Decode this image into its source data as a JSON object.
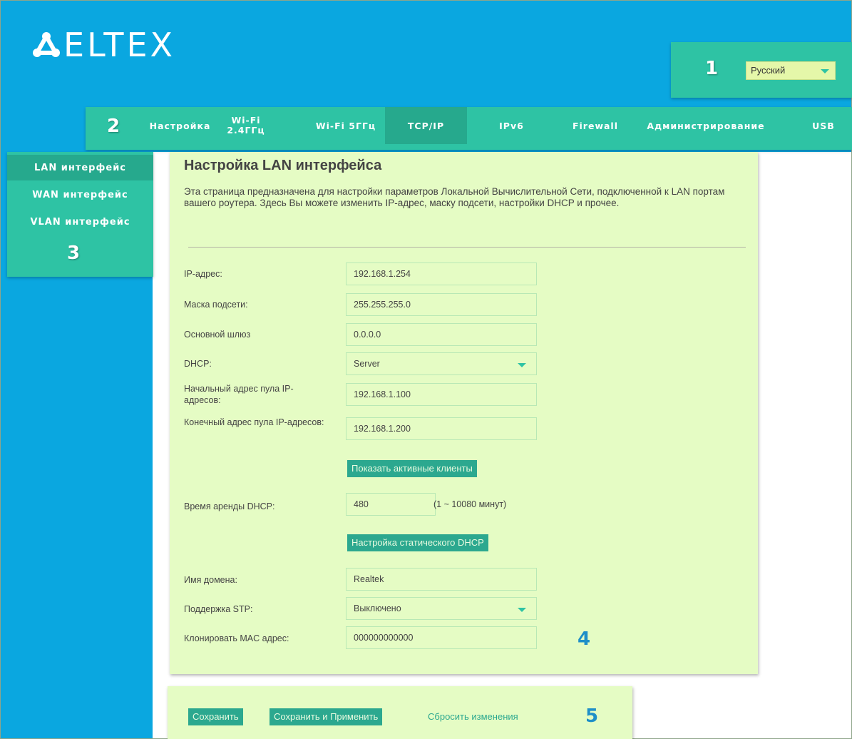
{
  "header": {
    "logo_text": "ELTEX",
    "language": {
      "badge": "1",
      "selected": "Русский"
    }
  },
  "nav": {
    "badge": "2",
    "items": [
      {
        "label": "Настройка",
        "active": false
      },
      {
        "label": "Wi-Fi 2.4ГГц",
        "line1": "Wi-Fi",
        "line2": "2.4ГГц",
        "active": false
      },
      {
        "label": "Wi-Fi 5ГГц",
        "active": false
      },
      {
        "label": "TCP/IP",
        "active": true
      },
      {
        "label": "IPv6",
        "active": false
      },
      {
        "label": "Firewall",
        "active": false
      },
      {
        "label": "Администрирование",
        "active": false
      },
      {
        "label": "USB",
        "active": false
      }
    ]
  },
  "sidebar": {
    "badge": "3",
    "items": [
      {
        "label": "LAN интерфейс",
        "active": true
      },
      {
        "label": "WAN интерфейс",
        "active": false
      },
      {
        "label": "VLAN интерфейс",
        "active": false
      }
    ]
  },
  "main": {
    "badge": "4",
    "title": "Настройка LAN интерфейса",
    "description": "Эта страница предназначена для настройки параметров Локальной Вычислительной Сети, подключенной к LAN портам вашего роутера. Здесь Вы можете изменить IP-адрес, маску подсети, настройки DHCP и прочее.",
    "fields": {
      "ip": {
        "label": "IP-адрес:",
        "value": "192.168.1.254"
      },
      "mask": {
        "label": "Маска подсети:",
        "value": "255.255.255.0"
      },
      "gateway": {
        "label": "Основной шлюз",
        "value": "0.0.0.0"
      },
      "dhcp": {
        "label": "DHCP:",
        "value": "Server"
      },
      "pool_start": {
        "label": "Начальный адрес пула IP-адресов:",
        "value": "192.168.1.100"
      },
      "pool_end": {
        "label": "Конечный адрес пула IP-адресов:",
        "value": "192.168.1.200"
      },
      "lease": {
        "label": "Время аренды DHCP:",
        "value": "480",
        "note": "(1 ~ 10080 минут)"
      },
      "domain": {
        "label": "Имя домена:",
        "value": "Realtek"
      },
      "stp": {
        "label": "Поддержка STP:",
        "value": "Выключено"
      },
      "mac": {
        "label": "Клонировать MAC адрес:",
        "value": "000000000000"
      }
    },
    "buttons": {
      "show_clients": "Показать активные клиенты",
      "static_dhcp": "Настройка статического DHCP"
    }
  },
  "footer": {
    "badge": "5",
    "save": "Сохранить",
    "save_apply": "Сохранить и Применить",
    "reset": "Сбросить изменения"
  },
  "colors": {
    "header_blue": "#0aa7e0",
    "teal": "#2ec3a4",
    "teal_active": "#26a98d",
    "panel_green": "#e5fcc4",
    "badge_blue": "#1f8fc8"
  }
}
